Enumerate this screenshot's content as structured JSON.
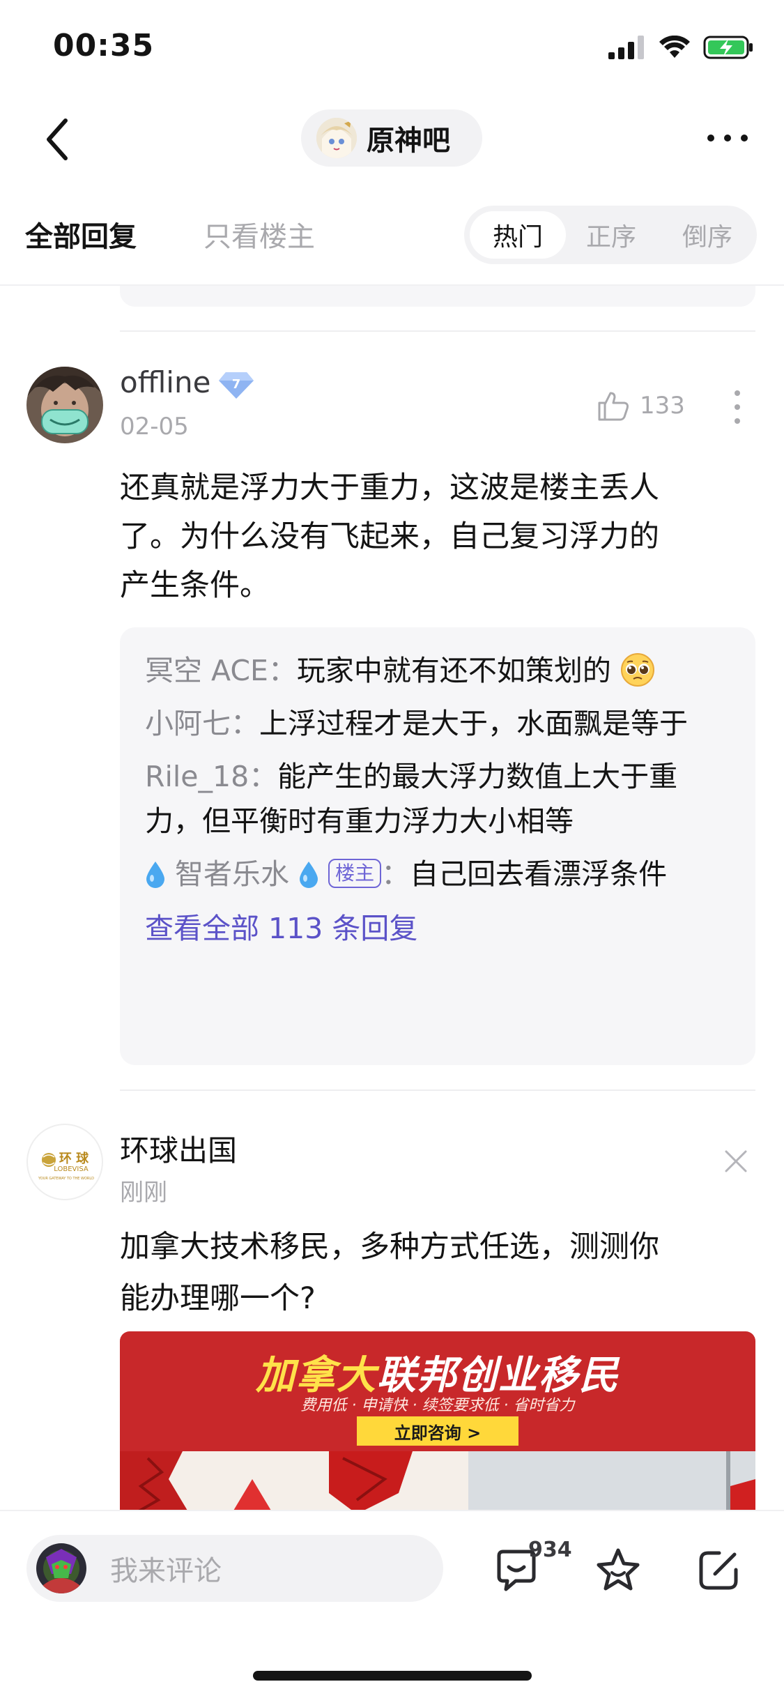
{
  "status_bar": {
    "time": "00:35"
  },
  "nav": {
    "forum_name": "原神吧"
  },
  "tabs": {
    "all_replies": "全部回复",
    "op_only": "只看楼主",
    "sort": [
      "热门",
      "正序",
      "倒序"
    ],
    "active_sort": "热门"
  },
  "post": {
    "username": "offline",
    "level": "7",
    "date": "02-05",
    "like_count": "133",
    "content": [
      "还真就是浮力大于重力，这波是楼主丢人",
      "了。为什么没有飞起来，自己复习浮力的",
      "产生条件。"
    ],
    "replies": [
      {
        "name": "冥空 ACE",
        "sep": "：",
        "text": "玩家中就有还不如策划的",
        "emoji": "pleading-face"
      },
      {
        "name": "小阿七",
        "sep": "：",
        "text": "上浮过程才是大于，水面飘是等于"
      },
      {
        "name": "Rile_18",
        "sep": "：",
        "text": "能产生的最大浮力数值上大于重力，但平衡时有重力浮力大小相等"
      },
      {
        "name": "智者乐水",
        "tag": "楼主",
        "sep": "：",
        "text": "自己回去看漂浮条件"
      }
    ],
    "view_all": "查看全部 113 条回复"
  },
  "ad": {
    "name": "环球出国",
    "time": "刚刚",
    "logo_text": "环 球",
    "logo_sub": "LOBEVISA",
    "logo_tagline": "YOUR GATEWAY TO THE WORLD",
    "content": [
      "加拿大技术移民，多种方式任选，测测你",
      "能办理哪一个?"
    ],
    "banner": {
      "title_yellow": "加拿大",
      "title_white": "联邦创业移民",
      "subtitle": "费用低 · 申请快 · 续签要求低 · 省时省力",
      "button": "立即咨询 >",
      "bg_color": "#c8282a"
    }
  },
  "bottom_bar": {
    "placeholder": "我来评论",
    "reply_count": "934"
  },
  "colors": {
    "accent": "#5b52c8",
    "op_tag": "#6e65d6",
    "battery": "#34c759"
  }
}
